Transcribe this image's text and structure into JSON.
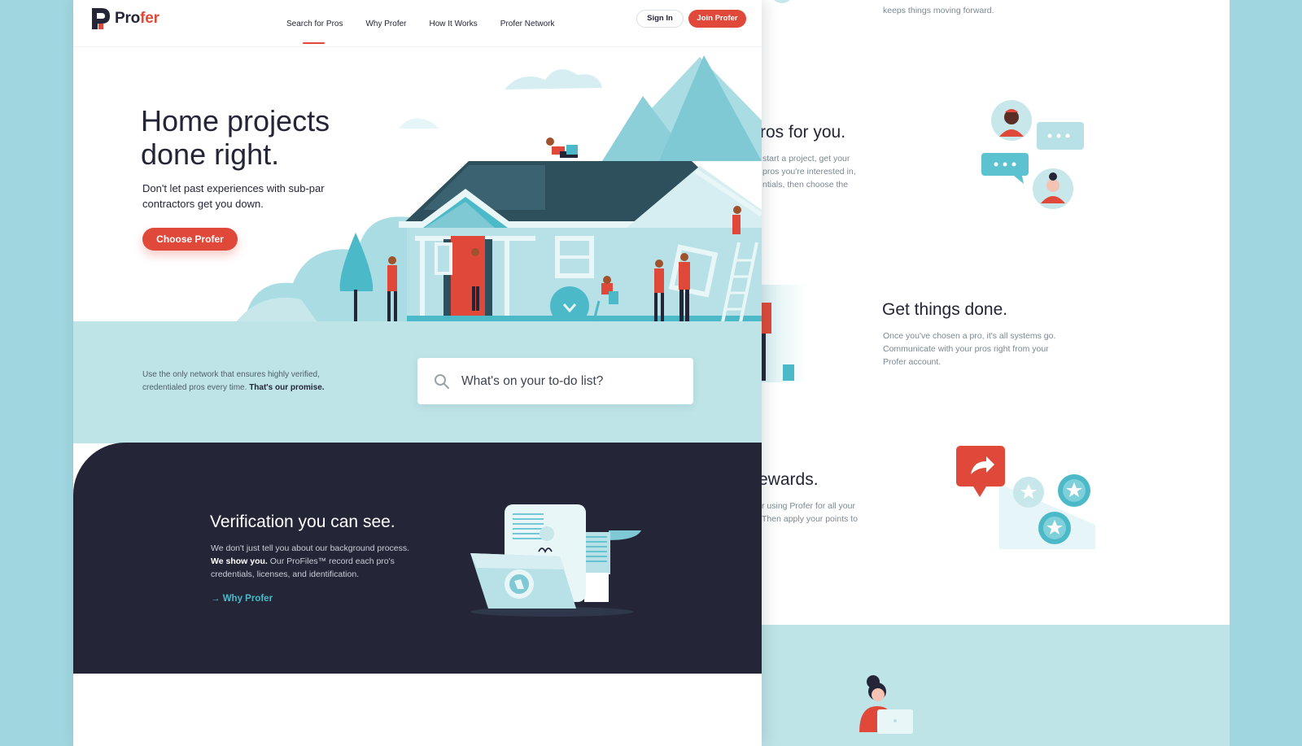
{
  "brand": {
    "logo_text_a": "Pro",
    "logo_text_b": "fer",
    "accent": "#e0493a",
    "teal": "#4bb9c7",
    "navy": "#242638"
  },
  "nav": {
    "links": [
      {
        "label": "Search for Pros",
        "active": true
      },
      {
        "label": "Why Profer"
      },
      {
        "label": "How It Works"
      },
      {
        "label": "Profer Network"
      }
    ],
    "sign_in": "Sign In",
    "join": "Join Profer"
  },
  "hero": {
    "title_line1": "Home projects",
    "title_line2": "done right.",
    "subtitle": "Don't let past experiences with sub-par contractors get you down.",
    "cta": "Choose Profer"
  },
  "search": {
    "promise_text": "Use the only network that ensures highly verified, credentialed pros every time.",
    "promise_bold": "That's our promise.",
    "placeholder": "What's on your to-do list?",
    "icon": "search-icon"
  },
  "verification": {
    "title": "Verification you can see.",
    "text_a": "We don't just tell you about our background process.",
    "text_bold": "We show you.",
    "text_b": "Our ProFiles™ record each pro's credentials, licenses, and identification.",
    "link": "Why Profer",
    "link_icon": "arrow-right-icon"
  },
  "back_page": {
    "top_text": "keeps things moving forward.",
    "pros_title": "ros for you.",
    "pros_text": "start a project, get your pros you're interested in, ntials, then choose the",
    "done_title": "Get things done.",
    "done_text": "Once you've chosen a pro, it's all systems go. Communicate with your pros right from your Profer account.",
    "rewards_title": "ewards.",
    "rewards_text": "r using Profer for all your Then apply your points to"
  }
}
